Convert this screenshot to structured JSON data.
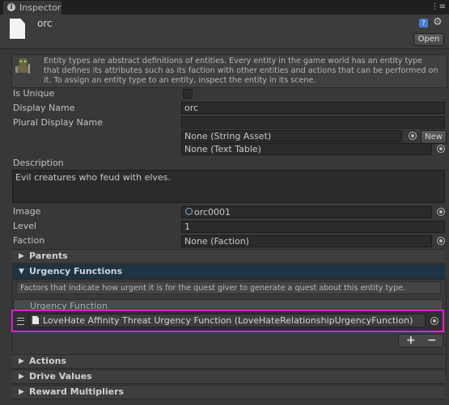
{
  "window": {
    "tab_title": "Inspector",
    "tab_menu": "⋮≡"
  },
  "header": {
    "object_name": "orc",
    "open_label": "Open"
  },
  "help": {
    "text": "Entity types are abstract definitions of entities. Every entity in the game world has an entity type that defines its attributes such as its faction with other entities and actions that can be performed on it. To assign an entity type to an entity, inspect the entity in its scene."
  },
  "fields": {
    "is_unique_label": "Is Unique",
    "is_unique_checked": false,
    "display_name_label": "Display Name",
    "display_name_value": "orc",
    "plural_label": "Plural Display Name",
    "plural_value": "",
    "string_asset_value": "None (String Asset)",
    "new_label": "New",
    "text_table_value": "None (Text Table)",
    "description_label": "Description",
    "description_value": "Evil creatures who feud with elves.",
    "image_label": "Image",
    "image_value": "orc0001",
    "level_label": "Level",
    "level_value": "1",
    "faction_label": "Faction",
    "faction_value": "None (Faction)"
  },
  "sections": {
    "parents": "Parents",
    "urgency": "Urgency Functions",
    "actions": "Actions",
    "drive": "Drive Values",
    "reward": "Reward Multipliers"
  },
  "urgency": {
    "help": "Factors that indicate how urgent it is for the quest giver to generate a quest about this entity type.",
    "list_header": "Urgency Function",
    "items": [
      "LoveHate Affinity Threat Urgency Function (LoveHateRelationshipUrgencyFunction)"
    ],
    "add": "+",
    "remove": "−"
  },
  "colors": {
    "selection": "#dd1fd6",
    "expanded_header": "#1d3346"
  }
}
